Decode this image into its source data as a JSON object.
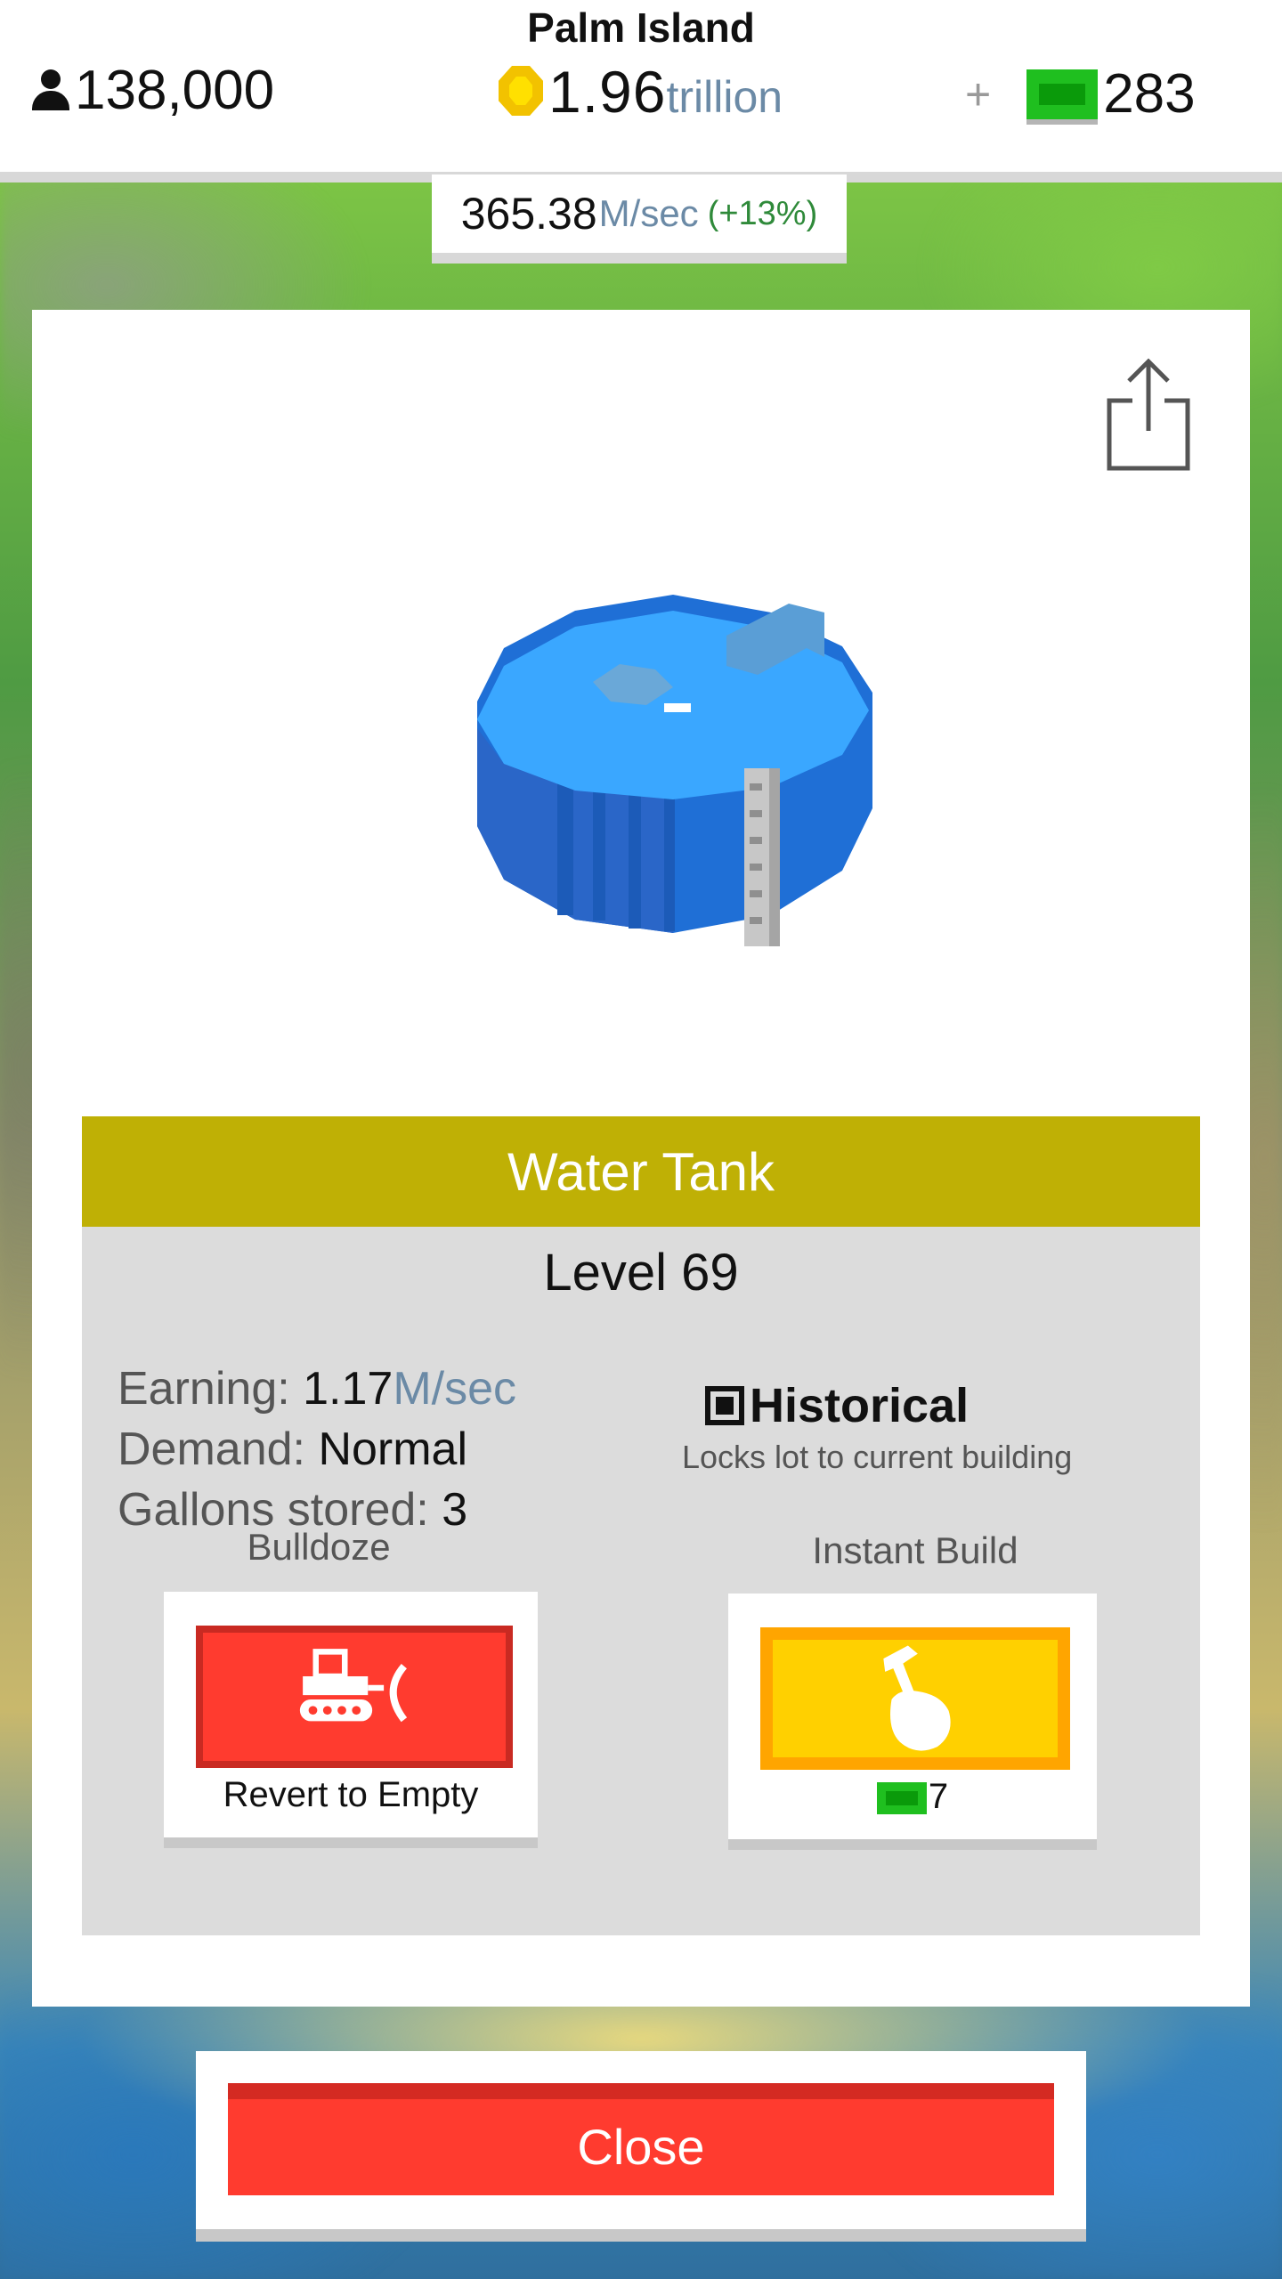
{
  "header": {
    "island_name": "Palm Island",
    "population": "138,000",
    "coins_value": "1.96",
    "coins_unit": "trillion",
    "plus": "+",
    "bucks": "283",
    "income_value": "365.38",
    "income_unit": "M/sec",
    "income_boost": "(+13%)"
  },
  "building": {
    "name": "Water Tank",
    "level": "Level 69",
    "earning_label": "Earning:",
    "earning_value": "1.17",
    "earning_unit": "M/sec",
    "demand_label": "Demand:",
    "demand_value": "Normal",
    "stored_label": "Gallons stored:",
    "stored_value": "3",
    "historical_label": "Historical",
    "historical_desc": "Locks lot to current building",
    "historical_checked": true
  },
  "actions": {
    "bulldoze_label": "Bulldoze",
    "bulldoze_caption": "Revert to Empty",
    "instant_label": "Instant Build",
    "instant_cost": "7"
  },
  "close_label": "Close",
  "colors": {
    "title_bar": "#bfb005",
    "bulldoze": "#ff3b2f",
    "instant": "#ffd000",
    "bucks_green": "#1fbf1f",
    "coin_yellow": "#ffe000"
  },
  "icons": [
    "person-icon",
    "coin-icon",
    "bill-icon",
    "share-icon",
    "bulldozer-icon",
    "hammer-hand-icon",
    "checkbox-icon"
  ]
}
